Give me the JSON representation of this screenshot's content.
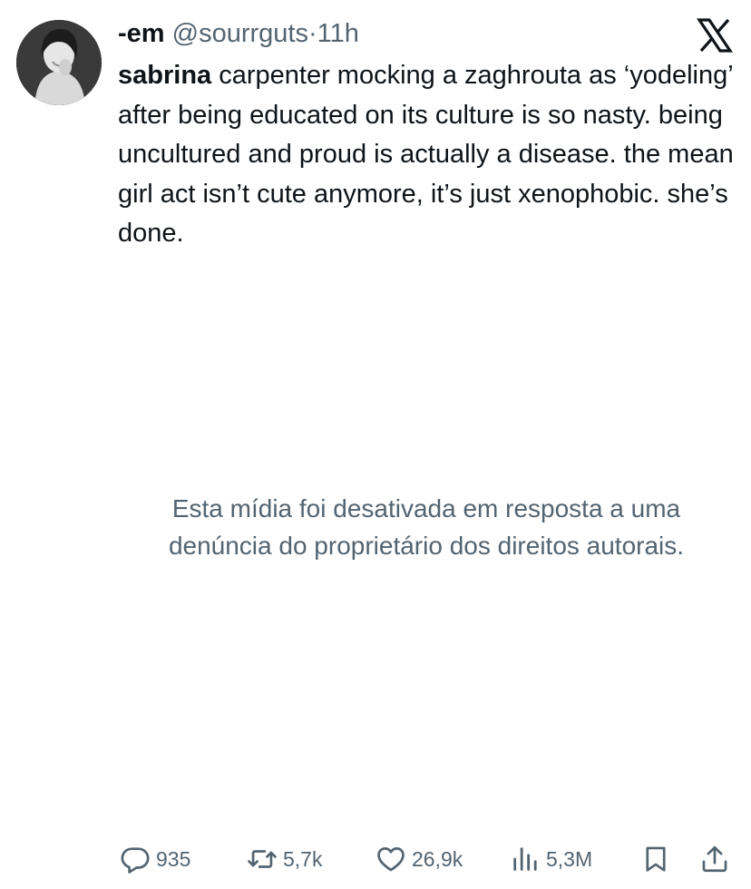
{
  "tweet": {
    "author": {
      "display_name": "-em",
      "handle": "@sourrguts",
      "separator": "·",
      "time": "11h"
    },
    "text": {
      "lead_bold": "sabrina",
      "body": " carpenter mocking a zaghrouta as ‘yodeling’ after being educated on its culture is so nasty. being uncultured and proud is actually a disease. the mean girl act isn’t cute anymore, it’s just xenophobic. she’s done."
    },
    "media_notice": "Esta mídia foi desativada em resposta a uma denúncia do proprietário dos direitos autorais.",
    "actions": {
      "replies": "935",
      "reposts": "5,7k",
      "likes": "26,9k",
      "views": "5,3M"
    }
  },
  "icons": {
    "brand": "x-logo-icon",
    "reply": "reply-icon",
    "repost": "repost-icon",
    "like": "heart-icon",
    "views": "views-icon",
    "bookmark": "bookmark-icon",
    "share": "share-icon"
  },
  "colors": {
    "text_primary": "#0f1419",
    "text_secondary": "#536471",
    "background": "#ffffff"
  }
}
